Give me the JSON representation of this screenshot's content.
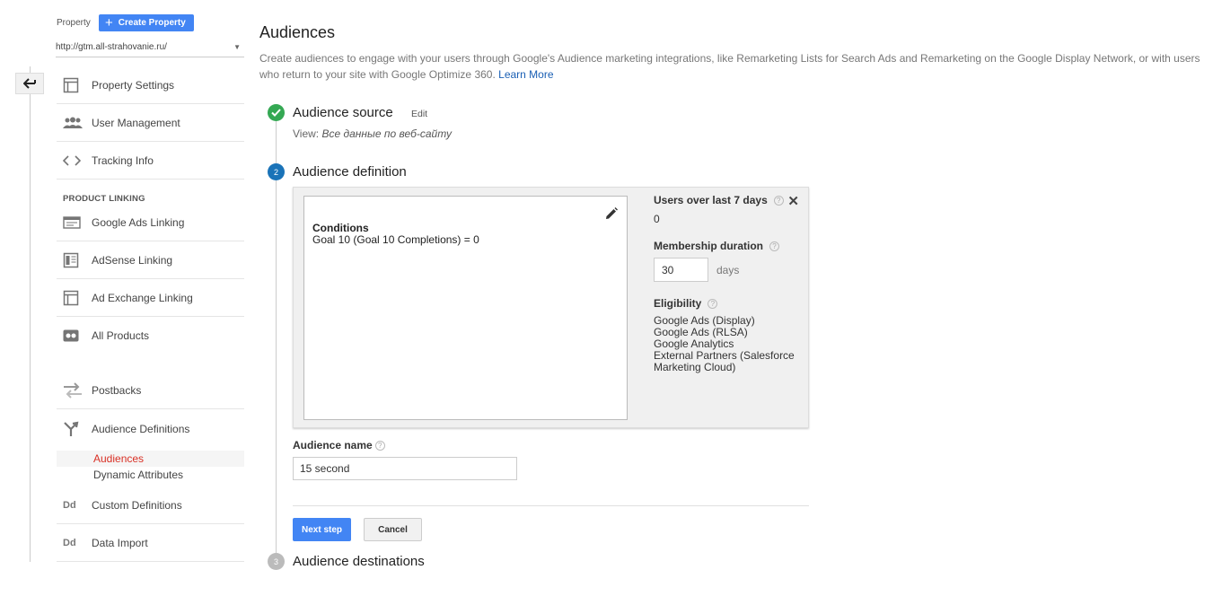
{
  "colors": {
    "accent": "#4285f4",
    "active_nav": "#d93025",
    "step_done": "#34a853",
    "step_current": "#1a73b8",
    "step_todo": "#bbbbbb"
  },
  "sidebar": {
    "property_label": "Property",
    "create_property_label": "Create Property",
    "property_url": "http://gtm.all-strahovanie.ru/",
    "items": [
      {
        "label": "Property Settings",
        "icon": "window-icon"
      },
      {
        "label": "User Management",
        "icon": "users-icon"
      },
      {
        "label": "Tracking Info",
        "icon": "code-icon"
      }
    ],
    "product_linking_heading": "PRODUCT LINKING",
    "linking_items": [
      {
        "label": "Google Ads Linking",
        "icon": "ads-icon"
      },
      {
        "label": "AdSense Linking",
        "icon": "adsense-icon"
      },
      {
        "label": "Ad Exchange Linking",
        "icon": "adexchange-icon"
      },
      {
        "label": "All Products",
        "icon": "products-icon"
      }
    ],
    "lower_items": [
      {
        "label": "Postbacks",
        "icon": "postbacks-icon"
      },
      {
        "label": "Audience Definitions",
        "icon": "fork-icon"
      }
    ],
    "sub_items": [
      {
        "label": "Audiences",
        "active": true
      },
      {
        "label": "Dynamic Attributes",
        "active": false
      }
    ],
    "bottom_items": [
      {
        "label": "Custom Definitions",
        "icon_text": "Dd"
      },
      {
        "label": "Data Import",
        "icon_text": "Dd"
      }
    ]
  },
  "main": {
    "title": "Audiences",
    "description": "Create audiences to engage with your users through Google's Audience marketing integrations, like Remarketing Lists for Search Ads and Remarketing on the Google Display Network, or with users who return to your site with Google Optimize 360.",
    "learn_more": "Learn More",
    "steps": {
      "source": {
        "title": "Audience source",
        "edit": "Edit",
        "view_label": "View:",
        "view_value": "Все данные по веб-сайту"
      },
      "definition": {
        "number": "2",
        "title": "Audience definition"
      },
      "destinations": {
        "number": "3",
        "title": "Audience destinations"
      }
    },
    "definition_box": {
      "conditions_title": "Conditions",
      "conditions_text": "Goal 10 (Goal 10 Completions) = 0",
      "users_label": "Users over last 7 days",
      "users_value": "0",
      "membership_label": "Membership duration",
      "membership_value": "30",
      "membership_unit": "days",
      "eligibility_label": "Eligibility",
      "eligibility": [
        "Google Ads (Display)",
        "Google Ads (RLSA)",
        "Google Analytics",
        "External Partners (Salesforce",
        "Marketing Cloud)"
      ]
    },
    "audience_name_label": "Audience name",
    "audience_name_value": "15 second",
    "next_step": "Next step",
    "cancel": "Cancel"
  }
}
